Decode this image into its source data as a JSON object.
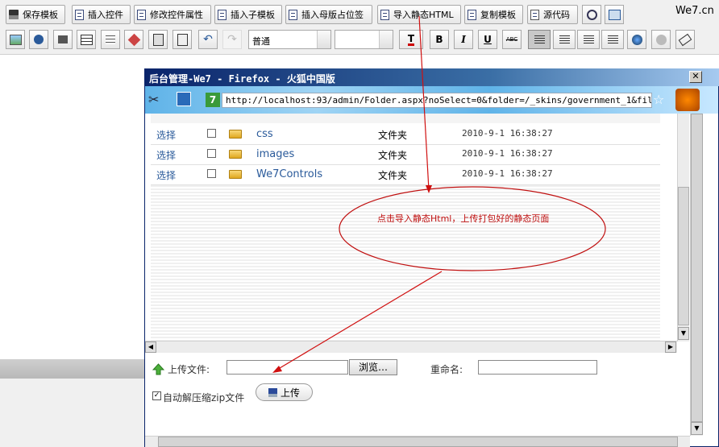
{
  "brand": "We7.cn",
  "toolbar": {
    "buttons": [
      "保存模板",
      "插入控件",
      "修改控件属性",
      "插入子模板",
      "插入母版占位签",
      "导入静态HTML",
      "复制模板",
      "源代码"
    ],
    "style_select": "普通",
    "size_select": "",
    "format": {
      "bold": "B",
      "italic": "I",
      "underline": "U",
      "strike": "ABC",
      "color": "T"
    }
  },
  "popup": {
    "title": "后台管理-We7 - Firefox - 火狐中国版",
    "url": "http://localhost:93/admin/Folder.aspx?noSelect=0&folder=/_skins/government_1&filter=*.h",
    "favicon_label": "7",
    "rows": [
      {
        "action": "选择",
        "name": "css",
        "type": "文件夹",
        "date": "2010-9-1 16:38:27"
      },
      {
        "action": "选择",
        "name": "images",
        "type": "文件夹",
        "date": "2010-9-1 16:38:27"
      },
      {
        "action": "选择",
        "name": "We7Controls",
        "type": "文件夹",
        "date": "2010-9-1 16:38:27"
      }
    ],
    "annotation": "点击导入静态Html，上传打包好的静态页面",
    "upload_label": "上传文件:",
    "browse_button": "浏览…",
    "rename_label": "重命名:",
    "unzip_label": "自动解压缩zip文件",
    "upload_button": "上传"
  }
}
